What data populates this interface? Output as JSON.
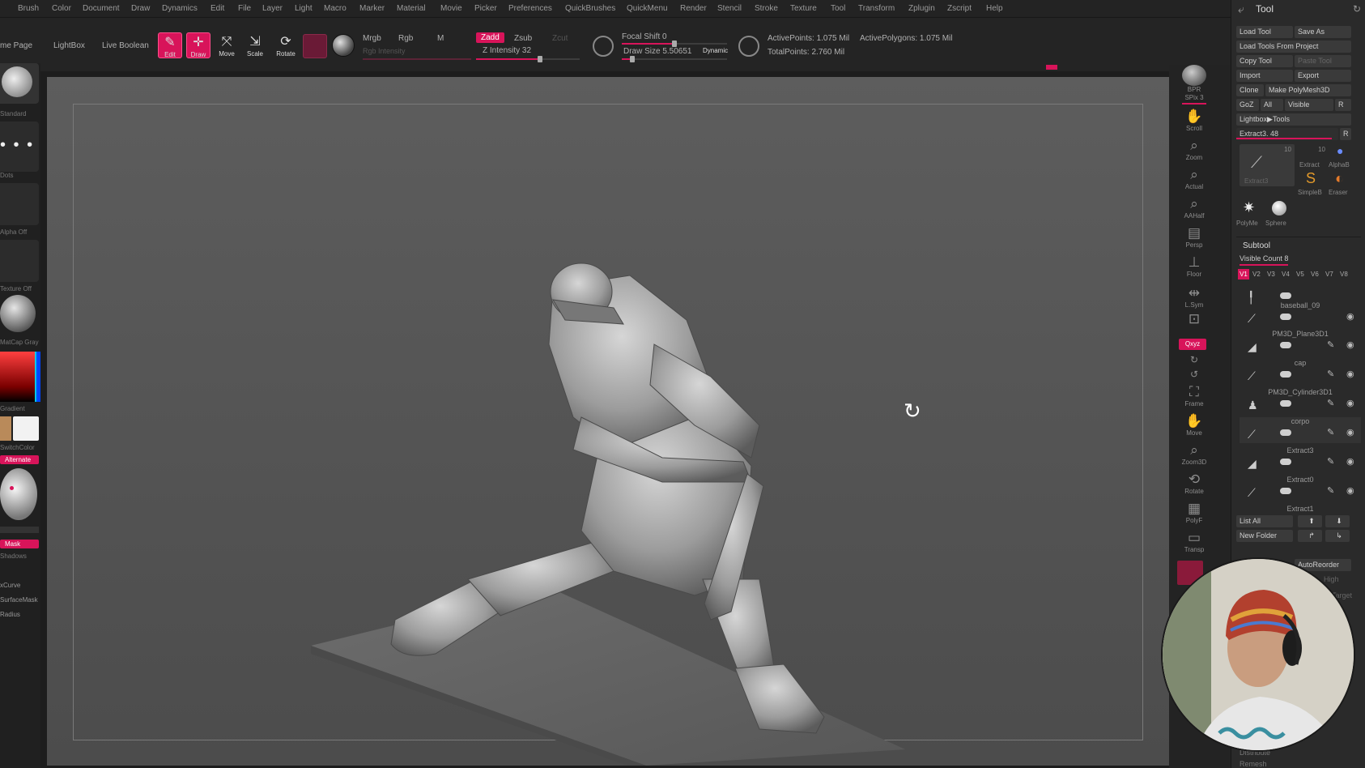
{
  "menubar": {
    "items": [
      "Brush",
      "Color",
      "Document",
      "Draw",
      "Dynamics",
      "Edit",
      "File",
      "Layer",
      "Light",
      "Macro",
      "Marker",
      "Material",
      "Movie",
      "Picker",
      "Preferences",
      "QuickBrushes",
      "QuickMenu",
      "Render",
      "Stencil",
      "Stroke",
      "Texture",
      "Tool",
      "Transform",
      "Zplugin",
      "Zscript",
      "Help"
    ]
  },
  "toolbar": {
    "home_page": "me Page",
    "lightbox": "LightBox",
    "live_boolean": "Live Boolean",
    "edit": "Edit",
    "draw": "Draw",
    "move": "Move",
    "scale": "Scale",
    "rotate": "Rotate",
    "mrgb": "Mrgb",
    "rgb": "Rgb",
    "m": "M",
    "rgb_intensity": "Rgb Intensity",
    "zadd": "Zadd",
    "zsub": "Zsub",
    "zcut": "Zcut",
    "z_intensity": "Z Intensity 32",
    "focal_shift": "Focal Shift 0",
    "draw_size": "Draw Size 5.50651",
    "dynamic": "Dynamic",
    "active_points": "ActivePoints: 1.075 Mil",
    "active_polygons": "ActivePolygons: 1.075 Mil",
    "total_points": "TotalPoints: 2.760 Mil",
    "accent": "#d8145a"
  },
  "left_tray": {
    "brush_label": "Standard",
    "stroke_label": "Dots",
    "alpha_label": "Alpha Off",
    "texture_label": "Texture Off",
    "material_label": "MatCap Gray",
    "gradient_label": "Gradient",
    "switch_color": "SwitchColor",
    "alternate": "Alternate",
    "mask_label": "Mask",
    "shadows": "Shadows",
    "curve_label": "xCurve",
    "surface_mask": "SurfaceMask",
    "radius": "Radius"
  },
  "right_tray": {
    "items": [
      {
        "icon": "bpr-icon",
        "label": "BPR"
      },
      {
        "icon": "spix-icon",
        "label": "SPix 3"
      },
      {
        "icon": "scroll-icon",
        "label": "Scroll"
      },
      {
        "icon": "zoom-icon",
        "label": "Zoom"
      },
      {
        "icon": "actual-icon",
        "label": "Actual"
      },
      {
        "icon": "aahalf-icon",
        "label": "AAHalf"
      },
      {
        "icon": "persp-icon",
        "label": "Persp"
      },
      {
        "icon": "floor-icon",
        "label": "Floor"
      },
      {
        "icon": "lsym-icon",
        "label": "L.Sym"
      },
      {
        "icon": "lock-icon",
        "label": ""
      },
      {
        "icon": "xyz-icon",
        "label": "Qxyz"
      },
      {
        "icon": "rotate-y-icon",
        "label": ""
      },
      {
        "icon": "rotate-z-icon",
        "label": ""
      },
      {
        "icon": "frame-icon",
        "label": "Frame"
      },
      {
        "icon": "move-icon",
        "label": "Move"
      },
      {
        "icon": "zoom3d-icon",
        "label": "Zoom3D"
      },
      {
        "icon": "rotate-icon",
        "label": "Rotate"
      },
      {
        "icon": "polyf-icon",
        "label": "PolyF"
      },
      {
        "icon": "transp-icon",
        "label": "Transp"
      }
    ]
  },
  "tool_panel": {
    "title": "Tool",
    "load_tool": "Load Tool",
    "save_as": "Save As",
    "load_from_project": "Load Tools From Project",
    "copy_tool": "Copy Tool",
    "paste_tool": "Paste Tool",
    "import": "Import",
    "export": "Export",
    "clone": "Clone",
    "make_polymesh": "Make PolyMesh3D",
    "goz": "GoZ",
    "all": "All",
    "visible": "Visible",
    "r": "R",
    "lightbox_tools": "Lightbox▶Tools",
    "current_tool": "Extract3. 48",
    "thumb_count_a": "10",
    "thumb_count_b": "10",
    "thumbs": [
      {
        "label": "Extract3"
      },
      {
        "label": "Extract"
      },
      {
        "label": "AlphaB"
      },
      {
        "label": "SimpleB"
      },
      {
        "label": "Eraser"
      },
      {
        "label": "PolyMe"
      },
      {
        "label": "Sphere"
      }
    ],
    "subtool_title": "Subtool",
    "visible_count": "Visible Count 8",
    "versions": [
      "V1",
      "V2",
      "V3",
      "V4",
      "V5",
      "V6",
      "V7",
      "V8"
    ],
    "subtools": [
      "baseball_09",
      "PM3D_Plane3D1",
      "cap",
      "PM3D_Cylinder3D1",
      "corpo",
      "Extract3",
      "Extract0",
      "Extract1"
    ],
    "list_all": "List All",
    "new_folder": "New Folder",
    "auto_reorder": "AutoReorder",
    "high": "High",
    "target": "Target",
    "distribute": "Distribute",
    "remesh": "Remesh"
  }
}
